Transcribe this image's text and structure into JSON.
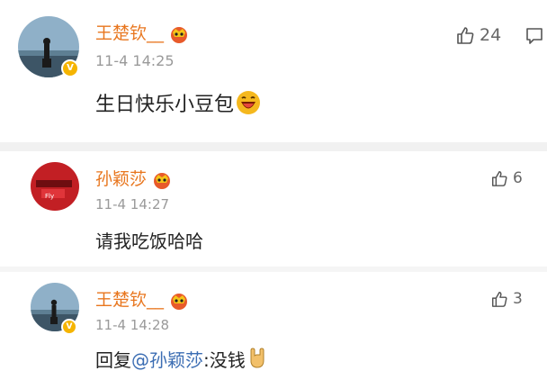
{
  "comments": [
    {
      "user": "王楚钦__",
      "time": "11-4 14:25",
      "text": "生日快乐小豆包",
      "text_emoji": "laugh-emoji",
      "likes": "24",
      "verified": true
    },
    {
      "user": "孙颖莎",
      "time": "11-4 14:27",
      "text": "请我吃饭哈哈",
      "likes": "6",
      "verified": false
    },
    {
      "user": "王楚钦__",
      "time": "11-4 14:28",
      "reply_prefix": "回复",
      "mention": "@孙颖莎",
      "reply_suffix": ":没钱",
      "text_emoji": "rock-hand-emoji",
      "likes": "3",
      "verified": true
    }
  ],
  "colors": {
    "username": "#e8761e",
    "mention": "#3b6db3",
    "verified_badge": "#f5b400",
    "separator": "#f1f1f1"
  }
}
